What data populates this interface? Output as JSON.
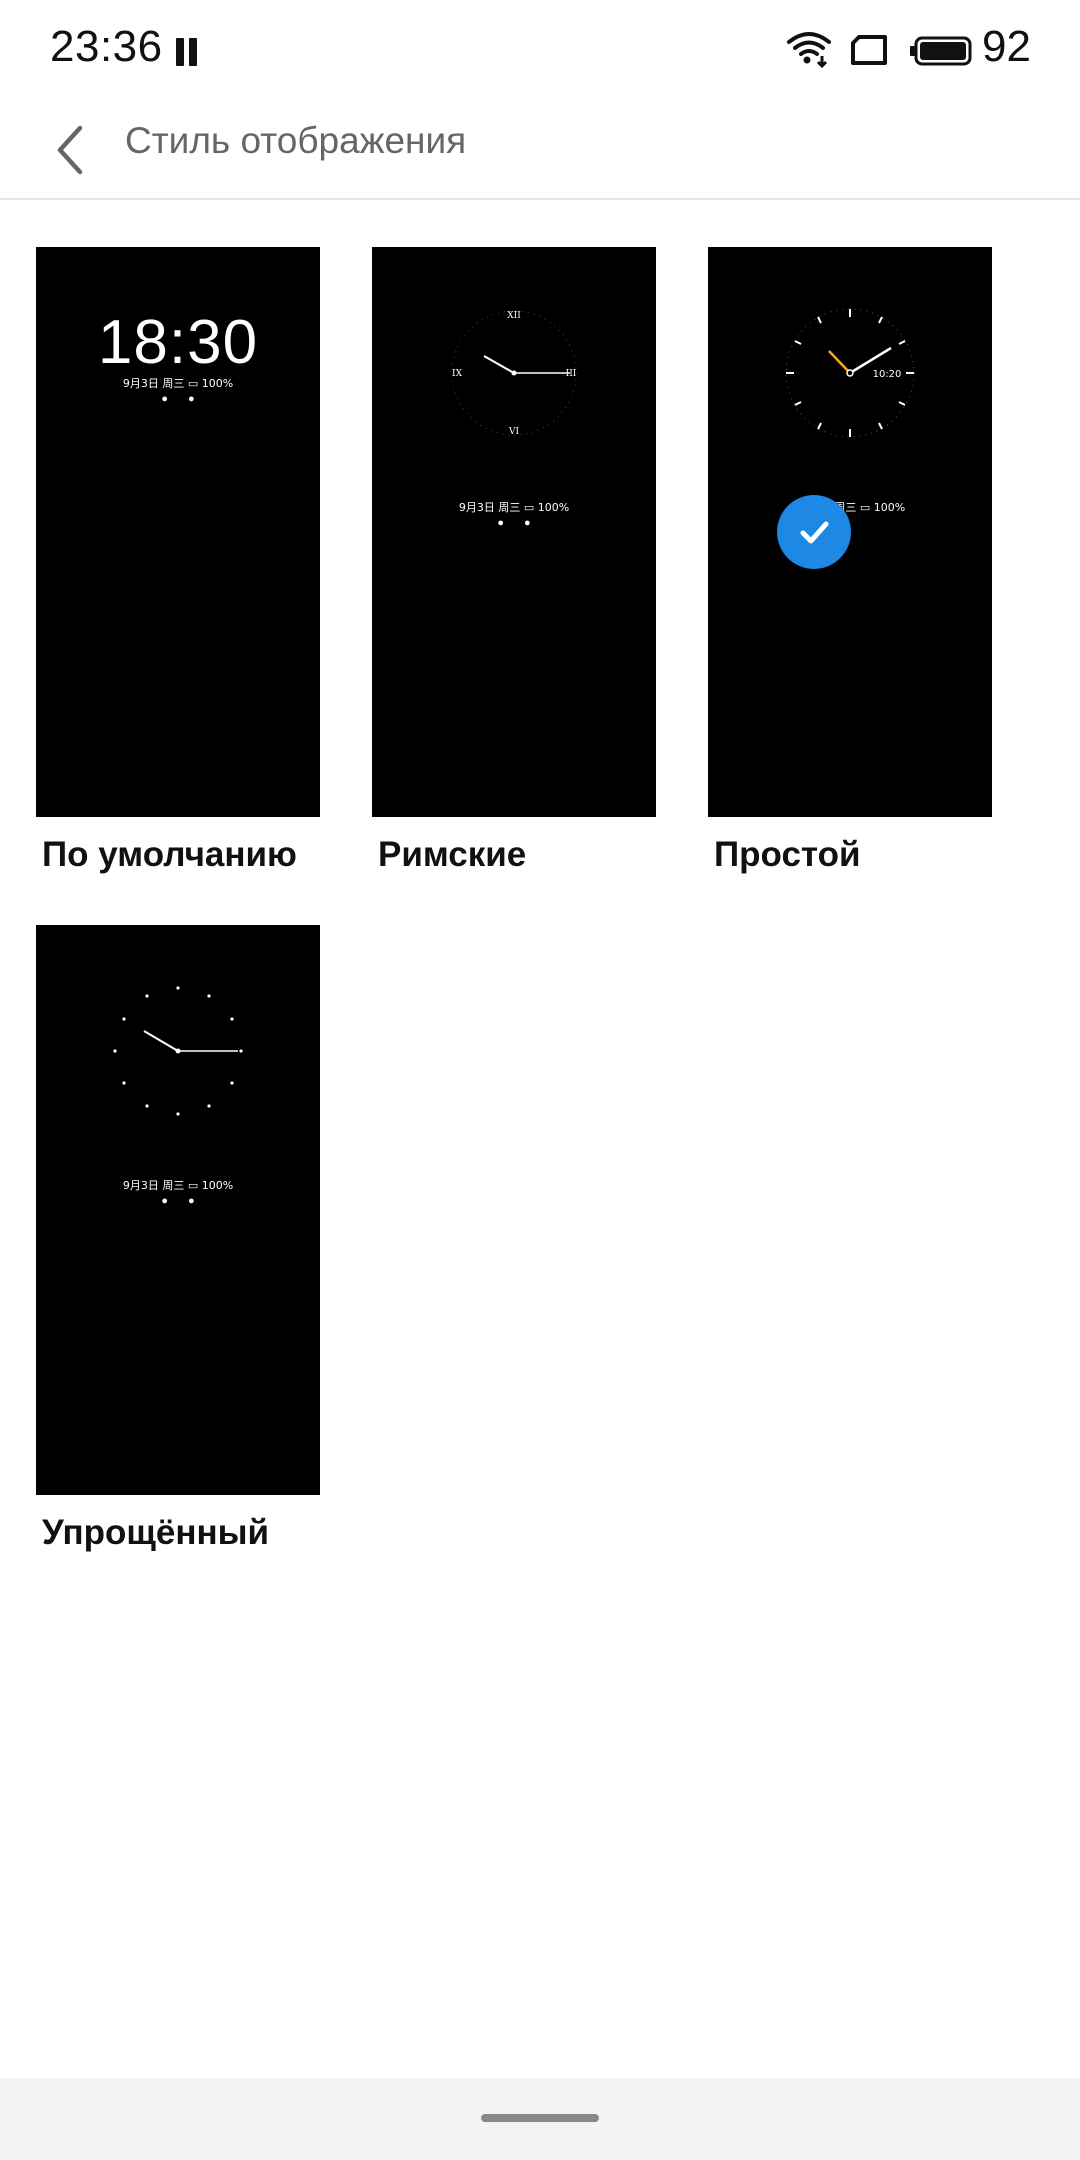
{
  "status": {
    "time": "23:36",
    "battery": "92"
  },
  "header": {
    "title": "Стиль отображения"
  },
  "styles": [
    {
      "label": "По умолчанию",
      "preview_time": "18:30",
      "preview_info": "9月3日  周三  ▭ 100%",
      "selected": false
    },
    {
      "label": "Римские",
      "preview_info": "9月3日  周三  ▭ 100%",
      "selected": false
    },
    {
      "label": "Простой",
      "preview_clock_text": "10:20",
      "preview_info": "9月3日  周三  ▭ 100%",
      "selected": true
    },
    {
      "label": "Упрощённый",
      "preview_info": "9月3日  周三  ▭ 100%",
      "selected": false
    }
  ],
  "icons": {
    "back": "chevron-left-icon",
    "check": "check-icon",
    "wifi": "wifi-icon",
    "sim": "sim-card-icon",
    "battery": "battery-icon",
    "pause": "pause-icon"
  },
  "colors": {
    "accent": "#1e88e5",
    "hour_hand_simple": "#f5a623"
  }
}
